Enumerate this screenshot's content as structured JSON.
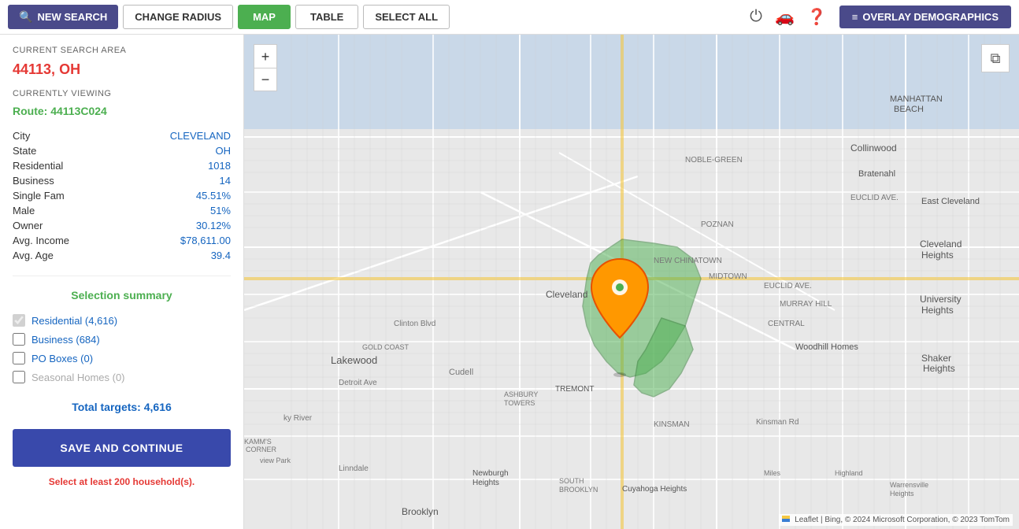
{
  "toolbar": {
    "new_search_label": "NEW SEARCH",
    "change_radius_label": "CHANGE RADIUS",
    "map_label": "MAP",
    "table_label": "TABLE",
    "select_all_label": "SELECT ALL",
    "overlay_label": "OVERLAY DEMOGRAPHICS"
  },
  "left_panel": {
    "current_search_area_label": "CURRENT SEARCH AREA",
    "area_value": "44113, OH",
    "currently_viewing_label": "CURRENTLY VIEWING",
    "route_value": "Route: 44113C024",
    "stats": [
      {
        "label": "City",
        "value": "CLEVELAND"
      },
      {
        "label": "State",
        "value": "OH"
      },
      {
        "label": "Residential",
        "value": "1018"
      },
      {
        "label": "Business",
        "value": "14"
      },
      {
        "label": "Single Fam",
        "value": "45.51%"
      },
      {
        "label": "Male",
        "value": "51%"
      },
      {
        "label": "Owner",
        "value": "30.12%"
      },
      {
        "label": "Avg. Income",
        "value": "$78,611.00"
      },
      {
        "label": "Avg. Age",
        "value": "39.4"
      }
    ],
    "selection_summary_title": "Selection summary",
    "checkboxes": [
      {
        "id": "cb-residential",
        "label": "Residential (4,616)",
        "checked": true,
        "disabled": true,
        "color": "blue"
      },
      {
        "id": "cb-business",
        "label": "Business (684)",
        "checked": false,
        "disabled": false,
        "color": "blue"
      },
      {
        "id": "cb-poboxes",
        "label": "PO Boxes (0)",
        "checked": false,
        "disabled": false,
        "color": "blue"
      },
      {
        "id": "cb-seasonal",
        "label": "Seasonal Homes (0)",
        "checked": false,
        "disabled": false,
        "color": "gray"
      }
    ],
    "total_targets_label": "Total targets:",
    "total_targets_value": "4,616",
    "save_button_label": "SAVE AND CONTINUE",
    "save_hint_pre": "Select at least ",
    "save_hint_number": "200",
    "save_hint_post": " household(s)."
  },
  "map": {
    "zoom_in_label": "+",
    "zoom_out_label": "−",
    "attribution": "Leaflet | Bing, © 2024 Microsoft Corporation, © 2023 TomTom"
  }
}
